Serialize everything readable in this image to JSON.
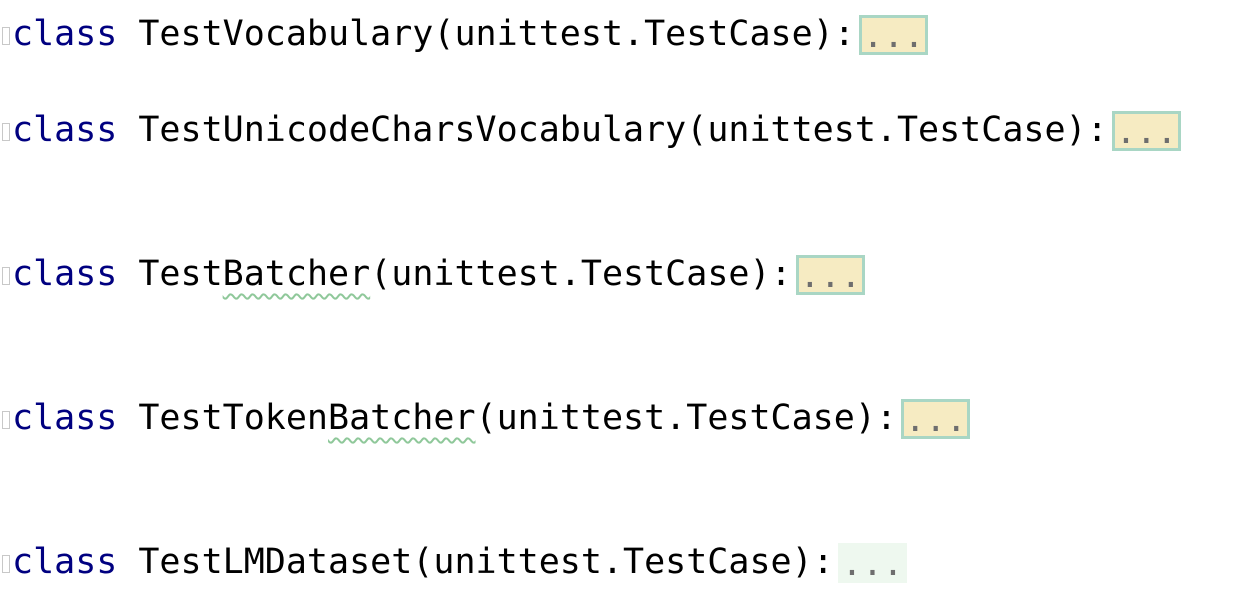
{
  "editor": {
    "lines": [
      {
        "keyword": "class",
        "name_plain_1": "TestVocabulary",
        "name_squiggle": "",
        "name_plain_2": "",
        "open": "(",
        "base": "unittest.TestCase",
        "close": "):",
        "folded": "..."
      },
      {
        "keyword": "class",
        "name_plain_1": "TestUnicodeCharsVocabulary",
        "name_squiggle": "",
        "name_plain_2": "",
        "open": "(",
        "base": "unittest.TestCase",
        "close": "):",
        "folded": "..."
      },
      {
        "keyword": "class",
        "name_plain_1": "Test",
        "name_squiggle": "Batcher",
        "name_plain_2": "",
        "open": "(",
        "base": "unittest.TestCase",
        "close": "):",
        "folded": "..."
      },
      {
        "keyword": "class",
        "name_plain_1": "TestToken",
        "name_squiggle": "Batcher",
        "name_plain_2": "",
        "open": "(",
        "base": "unittest.TestCase",
        "close": "):",
        "folded": "..."
      },
      {
        "keyword": "class",
        "name_plain_1": "TestLMDataset",
        "name_squiggle": "",
        "name_plain_2": "",
        "open": "(",
        "base": "unittest.TestCase",
        "close": "):",
        "folded": "..."
      }
    ],
    "colors": {
      "keyword": "#000080",
      "fold_background": "#f6ebc2",
      "fold_border": "#a9d6c4",
      "spell_squiggle": "#8fc89a"
    }
  }
}
